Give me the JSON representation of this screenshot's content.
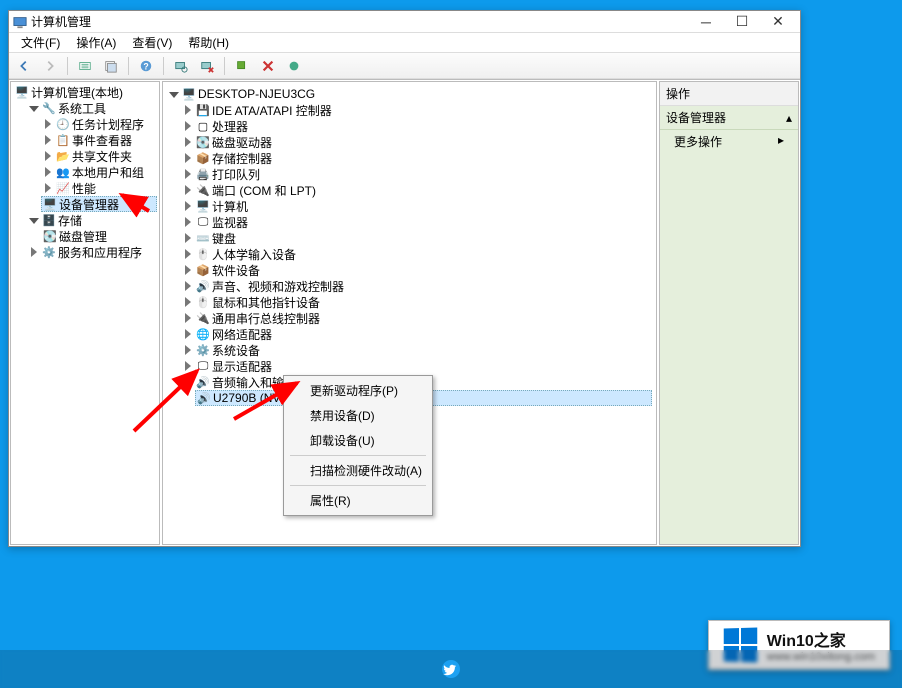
{
  "window": {
    "title": "计算机管理",
    "menus": [
      "文件(F)",
      "操作(A)",
      "查看(V)",
      "帮助(H)"
    ]
  },
  "nav_tree": {
    "root": "计算机管理(本地)",
    "system_tools": {
      "label": "系统工具",
      "children": [
        "任务计划程序",
        "事件查看器",
        "共享文件夹",
        "本地用户和组",
        "性能",
        "设备管理器"
      ]
    },
    "storage": {
      "label": "存储",
      "children": [
        "磁盘管理"
      ]
    },
    "services": "服务和应用程序"
  },
  "device_tree": {
    "root": "DESKTOP-NJEU3CG",
    "categories": [
      "IDE ATA/ATAPI 控制器",
      "处理器",
      "磁盘驱动器",
      "存储控制器",
      "打印队列",
      "端口 (COM 和 LPT)",
      "计算机",
      "监视器",
      "键盘",
      "人体学输入设备",
      "软件设备",
      "声音、视频和游戏控制器",
      "鼠标和其他指针设备",
      "通用串行总线控制器",
      "网络适配器",
      "系统设备",
      "显示适配器"
    ],
    "audio": {
      "label": "音频输入和输出",
      "selected": "U2790B (NVIDIA High Definition Audio)"
    }
  },
  "context_menu": [
    "更新驱动程序(P)",
    "禁用设备(D)",
    "卸载设备(U)",
    "扫描检测硬件改动(A)",
    "属性(R)"
  ],
  "actions_panel": {
    "head": "操作",
    "title": "设备管理器",
    "more": "更多操作"
  },
  "watermark": {
    "line1": "Win10之家",
    "line2": "www.win10xitong.com"
  }
}
